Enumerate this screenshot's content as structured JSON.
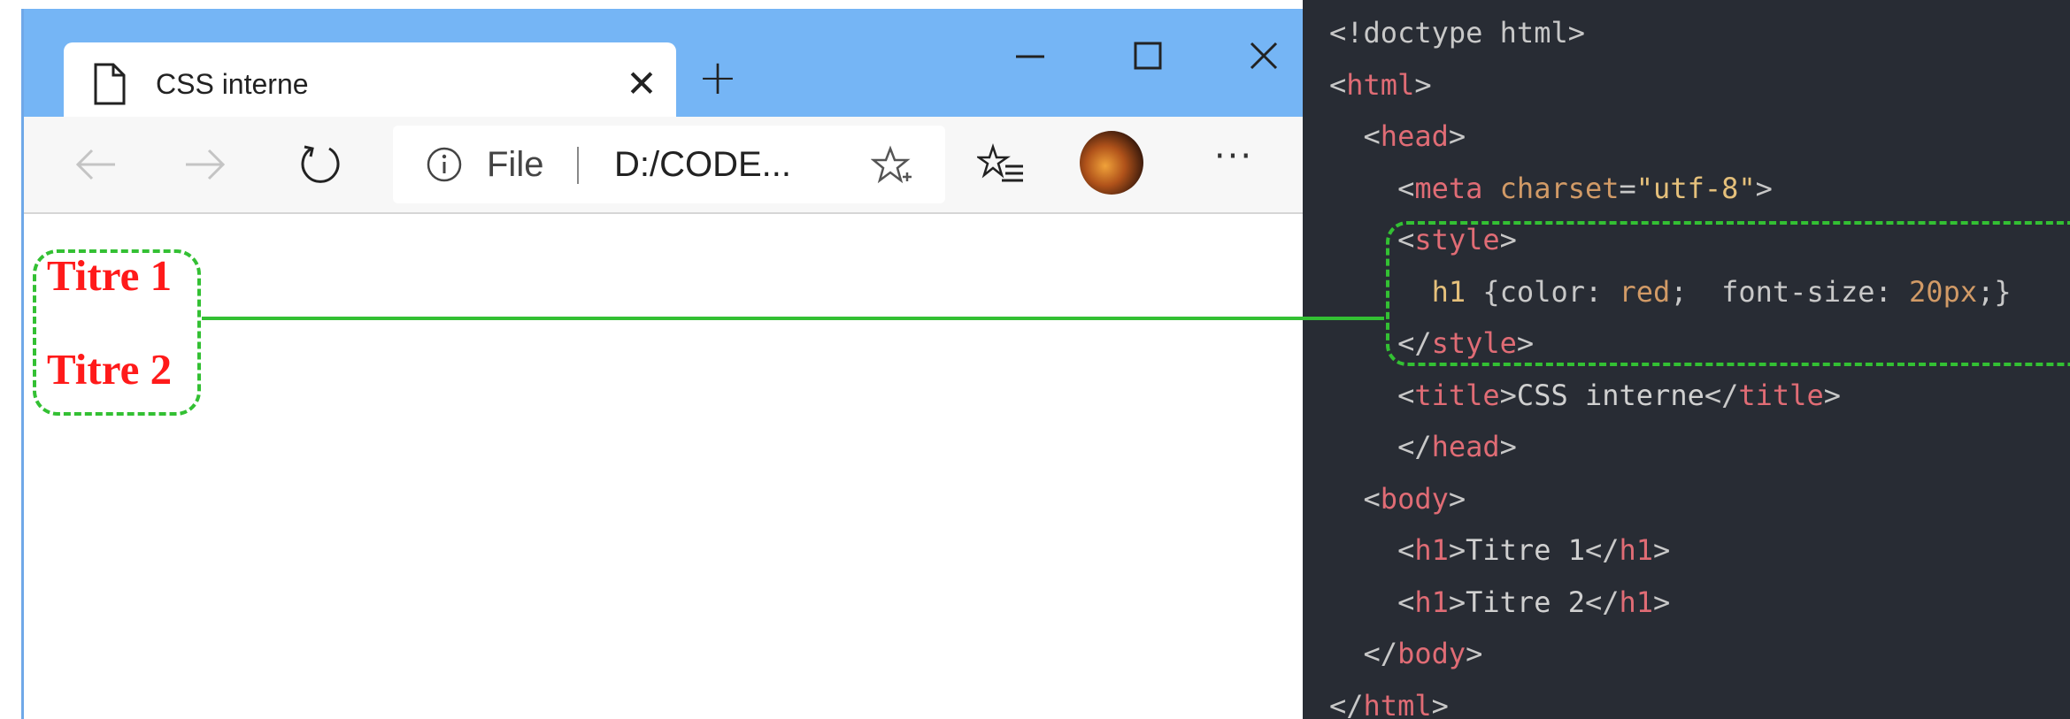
{
  "browser": {
    "tab_title": "CSS interne",
    "tab_close_glyph": "✕",
    "newtab_glyph": "+",
    "address": {
      "scheme_label": "File",
      "url": "D:/CODE..."
    },
    "more_glyph": "···",
    "page": {
      "headings": [
        "Titre 1",
        "Titre 2"
      ],
      "heading_color": "#ff1a1a"
    },
    "icons": [
      "page-icon",
      "close-icon",
      "plus-icon",
      "minimize-icon",
      "maximize-icon",
      "window-close-icon",
      "back-arrow-icon",
      "forward-arrow-icon",
      "reload-icon",
      "info-icon",
      "star-icon",
      "favorites-icon",
      "avatar",
      "more-icon"
    ],
    "colors": {
      "titlebar": "#75b5f5",
      "highlight": "#33c033"
    }
  },
  "code": {
    "lines": [
      [
        {
          "t": "<!doctype html>",
          "c": "punct"
        }
      ],
      [
        {
          "t": "<",
          "c": "punct"
        },
        {
          "t": "html",
          "c": "tag"
        },
        {
          "t": ">",
          "c": "punct"
        }
      ],
      [
        {
          "t": "  <",
          "c": "punct"
        },
        {
          "t": "head",
          "c": "tag"
        },
        {
          "t": ">",
          "c": "punct"
        }
      ],
      [
        {
          "t": "    <",
          "c": "punct"
        },
        {
          "t": "meta",
          "c": "tag"
        },
        {
          "t": " ",
          "c": "punct"
        },
        {
          "t": "charset",
          "c": "attr"
        },
        {
          "t": "=",
          "c": "punct"
        },
        {
          "t": "\"utf-8\"",
          "c": "str"
        },
        {
          "t": ">",
          "c": "punct"
        }
      ],
      [
        {
          "t": "    <",
          "c": "punct"
        },
        {
          "t": "style",
          "c": "tag"
        },
        {
          "t": ">",
          "c": "punct"
        }
      ],
      [
        {
          "t": "      ",
          "c": "punct"
        },
        {
          "t": "h1",
          "c": "str"
        },
        {
          "t": " {color: ",
          "c": "punct"
        },
        {
          "t": "red",
          "c": "attr"
        },
        {
          "t": ";  font-size: ",
          "c": "punct"
        },
        {
          "t": "20px",
          "c": "attr"
        },
        {
          "t": ";}",
          "c": "punct"
        }
      ],
      [
        {
          "t": "    </",
          "c": "punct"
        },
        {
          "t": "style",
          "c": "tag"
        },
        {
          "t": ">",
          "c": "punct"
        }
      ],
      [
        {
          "t": "    <",
          "c": "punct"
        },
        {
          "t": "title",
          "c": "tag"
        },
        {
          "t": ">",
          "c": "punct"
        },
        {
          "t": "CSS interne",
          "c": "txt"
        },
        {
          "t": "</",
          "c": "punct"
        },
        {
          "t": "title",
          "c": "tag"
        },
        {
          "t": ">",
          "c": "punct"
        }
      ],
      [
        {
          "t": "    </",
          "c": "punct"
        },
        {
          "t": "head",
          "c": "tag"
        },
        {
          "t": ">",
          "c": "punct"
        }
      ],
      [
        {
          "t": "  <",
          "c": "punct"
        },
        {
          "t": "body",
          "c": "tag"
        },
        {
          "t": ">",
          "c": "punct"
        }
      ],
      [
        {
          "t": "    <",
          "c": "punct"
        },
        {
          "t": "h1",
          "c": "tag"
        },
        {
          "t": ">",
          "c": "punct"
        },
        {
          "t": "Titre 1",
          "c": "txt"
        },
        {
          "t": "</",
          "c": "punct"
        },
        {
          "t": "h1",
          "c": "tag"
        },
        {
          "t": ">",
          "c": "punct"
        }
      ],
      [
        {
          "t": "    <",
          "c": "punct"
        },
        {
          "t": "h1",
          "c": "tag"
        },
        {
          "t": ">",
          "c": "punct"
        },
        {
          "t": "Titre 2",
          "c": "txt"
        },
        {
          "t": "</",
          "c": "punct"
        },
        {
          "t": "h1",
          "c": "tag"
        },
        {
          "t": ">",
          "c": "punct"
        }
      ],
      [
        {
          "t": "  </",
          "c": "punct"
        },
        {
          "t": "body",
          "c": "tag"
        },
        {
          "t": ">",
          "c": "punct"
        }
      ],
      [
        {
          "t": "</",
          "c": "punct"
        },
        {
          "t": "html",
          "c": "tag"
        },
        {
          "t": ">",
          "c": "punct"
        }
      ]
    ]
  }
}
